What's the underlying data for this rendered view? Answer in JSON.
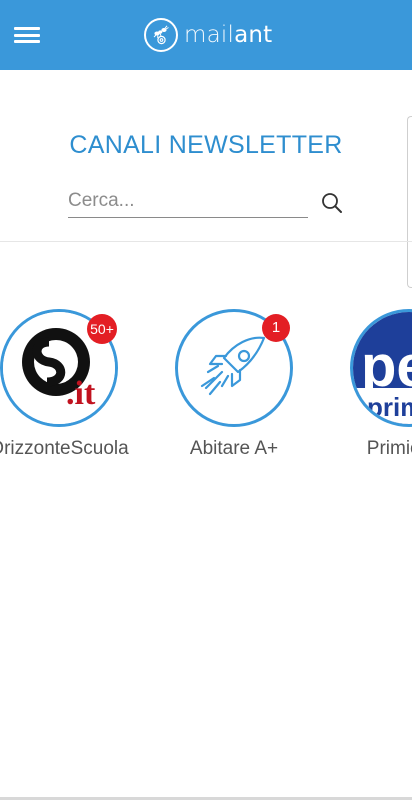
{
  "topbar": {
    "menu_icon": "hamburger-menu-icon",
    "logo_icon": "ant-at-icon",
    "logo_text_light": "mail",
    "logo_text_bold": "ant",
    "color": "#3a98da"
  },
  "header": {
    "title": "CANALI NEWSLETTER",
    "search_placeholder": "Cerca...",
    "search_icon": "search-icon",
    "title_color": "#2e8ecf"
  },
  "channels": [
    {
      "name": "OrizzonteScuola",
      "badge": "50+",
      "logo": "os-it-logo",
      "logo_text": "OS.it"
    },
    {
      "name": "Abitare A+",
      "badge": "1",
      "logo": "rocket-icon"
    },
    {
      "name": "Primicerio",
      "badge": "",
      "logo": "pe-primi-logo",
      "logo_text": "pe primi"
    }
  ],
  "colors": {
    "accent": "#3a98da",
    "badge": "#e31e24",
    "label": "#555555"
  }
}
